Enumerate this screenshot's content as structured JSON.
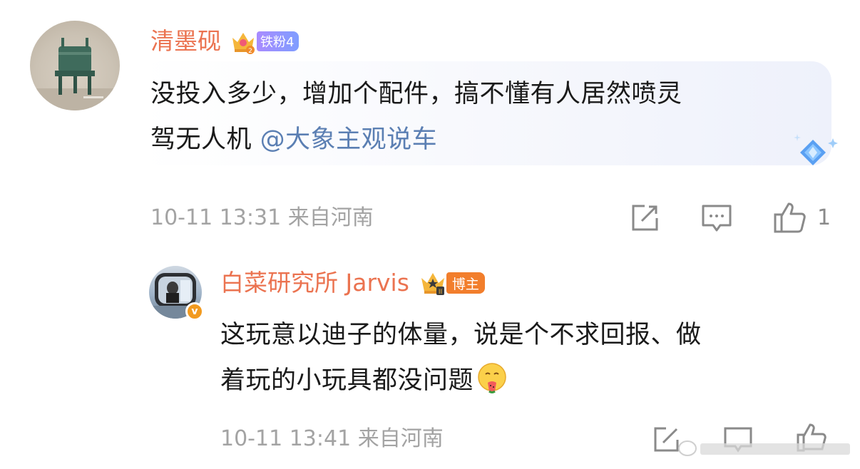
{
  "comment": {
    "username": "清墨砚",
    "fan_badge": "铁粉4",
    "body_lines": [
      "没投入多少，增加个配件，搞不懂有人居然喷灵",
      "驾无人机 "
    ],
    "mention": "@大象主观说车",
    "timestamp": "10-11 13:31",
    "location": "来自河南",
    "like_count": "1",
    "icons": [
      "share-icon",
      "comment-icon",
      "like-icon"
    ]
  },
  "reply": {
    "username": "白菜研究所 Jarvis",
    "host_badge": "博主",
    "body_lines": [
      "这玩意以迪子的体量，说是个不求回报、做",
      "着玩的小玩具都没问题"
    ],
    "emoji": "watermelon-emoji",
    "timestamp": "10-11 13:41",
    "location": "来自河南"
  },
  "colors": {
    "username": "#eb7350",
    "mention": "#5b7fb3",
    "meta": "#a3a3a3",
    "verified": "#f29a1f",
    "host_badge": "#f27e2c"
  }
}
